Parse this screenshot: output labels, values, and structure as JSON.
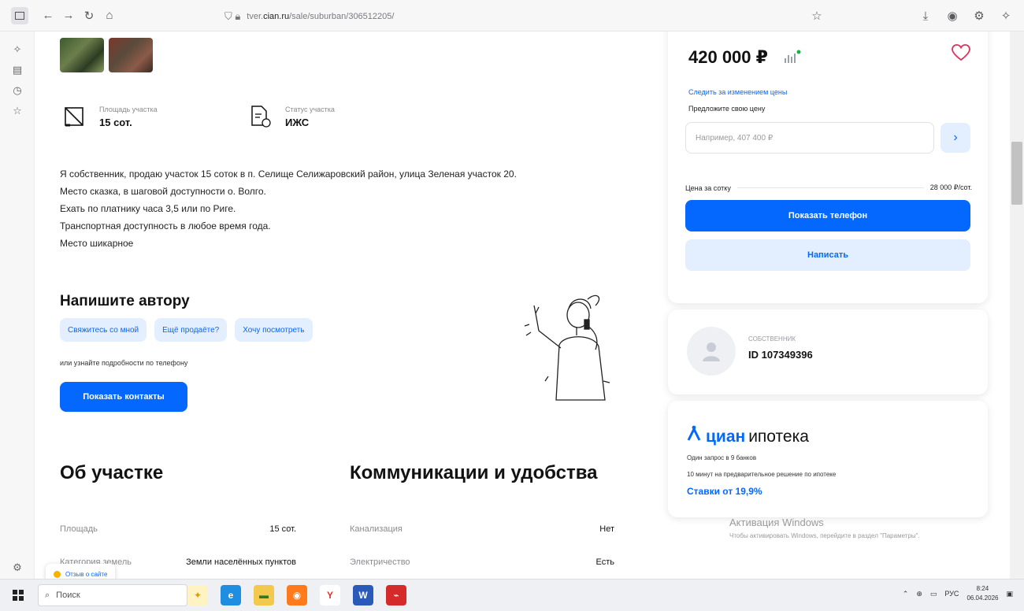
{
  "browser": {
    "url_prefix": "tver.",
    "url_host": "cian.ru",
    "url_path": "/sale/suburban/306512205/"
  },
  "listing": {
    "facts": [
      {
        "label": "Площадь участка",
        "value": "15 сот."
      },
      {
        "label": "Статус участка",
        "value": "ИЖС"
      }
    ],
    "description": [
      "Я собственник, продаю участок 15 соток в  п. Селище Селижаровский район, улица Зеленая участок 20.",
      "Место сказка, в шаговой доступности о. Волго.",
      "Ехать по платнику часа 3,5 или по Риге.",
      "Транспортная доступность в любое время года.",
      "Место шикарное"
    ],
    "write_author": {
      "title": "Напишите автору",
      "chips": [
        "Свяжитесь со мной",
        "Ещё продаёте?",
        "Хочу посмотреть"
      ],
      "or_phone": "или узнайте подробности по телефону",
      "contacts_button": "Показать контакты"
    },
    "about": {
      "title": "Об участке",
      "rows": [
        {
          "label": "Площадь",
          "value": "15 сот."
        },
        {
          "label": "Категория земель",
          "value": "Земли населённых пунктов"
        }
      ]
    },
    "communications": {
      "title": "Коммуникации и удобства",
      "rows": [
        {
          "label": "Канализация",
          "value": "Нет"
        },
        {
          "label": "Электричество",
          "value": "Есть"
        }
      ]
    }
  },
  "price_card": {
    "price": "420 000 ₽",
    "follow": "Следить за изменением цены",
    "offer_label": "Предложите свою цену",
    "offer_placeholder": "Например, 407 400 ₽",
    "per_sotka_label": "Цена за сотку",
    "per_sotka_value": "28 000 ₽/сот.",
    "phone_button": "Показать телефон",
    "write_button": "Написать"
  },
  "owner_card": {
    "type": "СОБСТВЕННИК",
    "id": "ID 107349396"
  },
  "mortgage": {
    "brand": "циан",
    "sub": "ипотека",
    "line1": "Один запрос в 9 банков",
    "line2": "10 минут на предварительное решение по ипотеке",
    "rates": "Ставки от 19,9%"
  },
  "windows_activation": {
    "title": "Активация Windows",
    "text": "Чтобы активировать Windows, перейдите в раздел \"Параметры\"."
  },
  "feedback": "Отзыв о сайте",
  "taskbar": {
    "search": "Поиск",
    "lang": "РУС",
    "time": "8:24",
    "date": "06.04.2026"
  },
  "colors": {
    "accent": "#0468ff",
    "accent_light": "#e3efff"
  }
}
